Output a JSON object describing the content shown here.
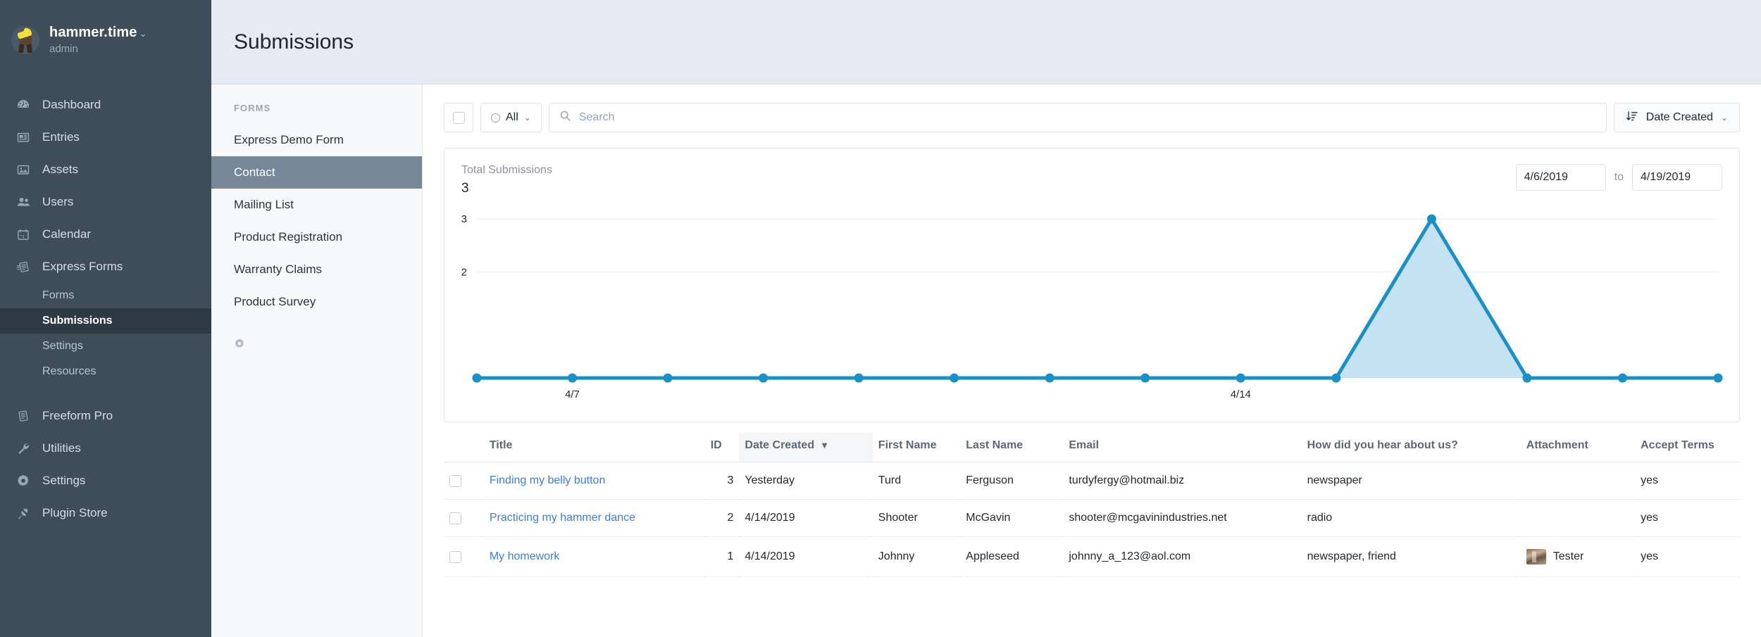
{
  "sidebar": {
    "account": {
      "name": "hammer.time",
      "chevron": "⌄",
      "role": "admin",
      "avatar_icon": "user-avatar-icon"
    },
    "items": [
      {
        "label": "Dashboard",
        "icon": "dashboard-icon"
      },
      {
        "label": "Entries",
        "icon": "entries-icon"
      },
      {
        "label": "Assets",
        "icon": "assets-icon"
      },
      {
        "label": "Users",
        "icon": "users-icon"
      },
      {
        "label": "Calendar",
        "icon": "calendar-icon"
      },
      {
        "label": "Express Forms",
        "icon": "express-forms-icon"
      }
    ],
    "sub_items": [
      {
        "label": "Forms",
        "active": false
      },
      {
        "label": "Submissions",
        "active": true
      },
      {
        "label": "Settings",
        "active": false
      },
      {
        "label": "Resources",
        "active": false
      }
    ],
    "items_bottom": [
      {
        "label": "Freeform Pro",
        "icon": "freeform-pro-icon"
      },
      {
        "label": "Utilities",
        "icon": "wrench-icon"
      },
      {
        "label": "Settings",
        "icon": "gear-icon"
      },
      {
        "label": "Plugin Store",
        "icon": "plug-icon"
      }
    ]
  },
  "header": {
    "title": "Submissions"
  },
  "subnav": {
    "heading": "FORMS",
    "items": [
      {
        "label": "Express Demo Form",
        "active": false
      },
      {
        "label": "Contact",
        "active": true
      },
      {
        "label": "Mailing List",
        "active": false
      },
      {
        "label": "Product Registration",
        "active": false
      },
      {
        "label": "Warranty Claims",
        "active": false
      },
      {
        "label": "Product Survey",
        "active": false
      }
    ],
    "gear_icon": "gear-icon"
  },
  "toolbar": {
    "select_all_icon": "checkbox-icon",
    "filter_label": "All",
    "filter_chevron": "⌄",
    "search_placeholder": "Search",
    "search_value": "",
    "search_icon": "search-icon",
    "sort_label": "Date Created",
    "sort_icon": "sort-descending-icon",
    "sort_chevron": "⌄"
  },
  "chart_card": {
    "stat_label": "Total Submissions",
    "stat_value": "3",
    "date_from": "4/6/2019",
    "date_to": "4/19/2019",
    "to_label": "to"
  },
  "chart_data": {
    "type": "area",
    "title": "Total Submissions",
    "xlabel": "",
    "ylabel": "",
    "x": [
      "4/6",
      "4/7",
      "4/8",
      "4/9",
      "4/10",
      "4/11",
      "4/12",
      "4/13",
      "4/14",
      "4/15",
      "4/16",
      "4/17",
      "4/18",
      "4/19"
    ],
    "values": [
      0,
      0,
      0,
      0,
      0,
      0,
      0,
      0,
      0,
      0,
      3,
      0,
      0,
      0
    ],
    "tick_labels": [
      "",
      "4/7",
      "",
      "",
      "",
      "",
      "",
      "",
      "4/14",
      "",
      "",
      "",
      "",
      ""
    ],
    "ylim": [
      0,
      3
    ],
    "yticks": [
      2,
      3
    ],
    "ytick_labels": [
      "2",
      "3"
    ],
    "grid": true,
    "legend": "none",
    "line_color": "#1890c8",
    "fill_color": "#c5e2f2"
  },
  "table": {
    "columns": [
      {
        "key": "checkbox",
        "label": ""
      },
      {
        "key": "title",
        "label": "Title"
      },
      {
        "key": "id",
        "label": "ID"
      },
      {
        "key": "date",
        "label": "Date Created",
        "sorted": true,
        "sort_caret": "▼"
      },
      {
        "key": "first",
        "label": "First Name"
      },
      {
        "key": "last",
        "label": "Last Name"
      },
      {
        "key": "email",
        "label": "Email"
      },
      {
        "key": "hear",
        "label": "How did you hear about us?"
      },
      {
        "key": "attachment",
        "label": "Attachment"
      },
      {
        "key": "terms",
        "label": "Accept Terms"
      }
    ],
    "rows": [
      {
        "title": "Finding my belly button",
        "id": "3",
        "date": "Yesterday",
        "first": "Turd",
        "last": "Ferguson",
        "email": "turdyfergy@hotmail.biz",
        "hear": "newspaper",
        "attachment": "",
        "has_thumb": false,
        "terms": "yes"
      },
      {
        "title": "Practicing my hammer dance",
        "id": "2",
        "date": "4/14/2019",
        "first": "Shooter",
        "last": "McGavin",
        "email": "shooter@mcgavinindustries.net",
        "hear": "radio",
        "attachment": "",
        "has_thumb": false,
        "terms": "yes"
      },
      {
        "title": "My homework",
        "id": "1",
        "date": "4/14/2019",
        "first": "Johnny",
        "last": "Appleseed",
        "email": "johnny_a_123@aol.com",
        "hear": "newspaper, friend",
        "attachment": "Tester",
        "has_thumb": true,
        "terms": "yes"
      }
    ]
  },
  "colors": {
    "sidebar_bg": "#3f4d5a",
    "sidebar_active": "#2e3943",
    "subnav_active": "#778899",
    "link": "#3b7ddd",
    "chart_line": "#1890c8",
    "chart_fill": "#c5e2f2",
    "header_bg": "#e4ebf2"
  }
}
